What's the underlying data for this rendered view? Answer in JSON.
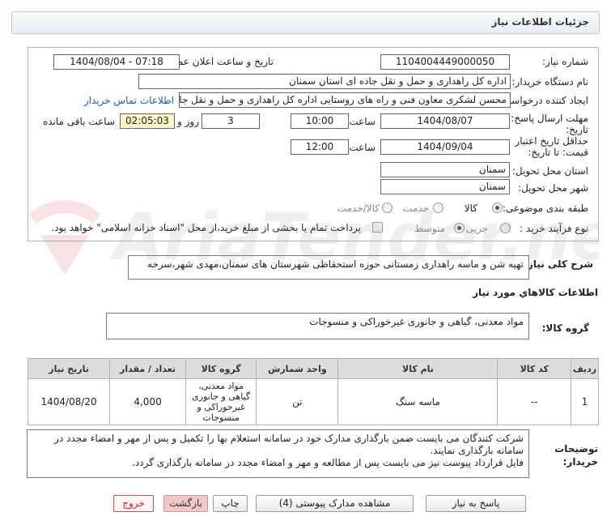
{
  "header": {
    "title": "جزئیات اطلاعات نیاز"
  },
  "fields": {
    "need_number_label": "شماره نیاز:",
    "need_number": "1104004449000050",
    "announce_label": "تاریخ و ساعت اعلان عمومی:",
    "announce_value": "1404/08/04 - 07:18",
    "buyer_org_label": "نام دستگاه خریدار:",
    "buyer_org": "اداره کل راهداری و حمل و نقل جاده ای استان سمنان",
    "creator_label": "ایجاد کننده درخواست:",
    "creator": "محسن لشکری معاون فنی و راه های روستایی اداره کل راهداری و حمل و نقل جاده",
    "contact_link": "اطلاعات تماس خریدار",
    "deadline_label": "مهلت ارسال پاسخ: تا تاریخ:",
    "deadline_date": "1404/08/07",
    "time_word": "ساعت",
    "deadline_time": "10:00",
    "days_value": "3",
    "days_word": "روز و",
    "remaining_time": "02:05:03",
    "remaining_label": "ساعت باقی مانده",
    "validity_label": "حداقل تاریخ اعتبار قیمت: تا تاریخ:",
    "validity_date": "1404/09/04",
    "validity_time": "12:00",
    "province_label": "استان محل تحویل:",
    "province": "سمنان",
    "city_label": "شهر محل تحویل:",
    "city": "سمنان",
    "category_label": "طبقه بندی موضوعی:",
    "category_options": [
      "کالا",
      "خدمت",
      "کالا/خدمت"
    ],
    "process_label": "نوع فرآیند خرید :",
    "process_options": [
      "جزیی",
      "متوسط"
    ],
    "payment_note": "پرداخت تمام یا بخشی از مبلغ خرید،از محل \"اسناد خزانه اسلامی\" خواهد بود."
  },
  "description": {
    "label": "شرح کلی نیاز:",
    "text": "تهیه شن و ماسه راهداری زمستانی حوزه استحفاظی شهرستان های سمنان،مهدی شهر،سرخه"
  },
  "goods_info_title": "اطلاعات کالاهاي مورد نياز",
  "goods_group": {
    "label": "گروه کالا:",
    "value": "مواد معدنی، گیاهی و جانوری غیرخوراکی و منسوجات"
  },
  "table": {
    "headers": [
      "ردیف",
      "کد کالا",
      "نام کالا",
      "واحد شمارش",
      "گروه کالا",
      "تعداد / مقدار",
      "تاریخ نیاز"
    ],
    "rows": [
      [
        "1",
        "--",
        "ماسه سنگ",
        "تن",
        "مواد معدنی، گیاهی و جانوری غیرخوراکی و منسوجات",
        "4,000",
        "1404/08/20"
      ]
    ]
  },
  "buyer_notes": {
    "label": "توضیحات خریدار:",
    "line1": "شرکت کنندگان می بایست ضمن بارگذاری مدارک خود در سامانه استعلام بها را تکمیل و پس از مهر و امضاء مجدد در سامانه بارگذاری نمایند.",
    "line2": "فایل قرارداد پیوست نیز می بایست پس از مطالعه و مهر و امضاء مجدد در سامانه بارگذاری گردد."
  },
  "buttons": {
    "reply": "پاسخ به نیاز",
    "attachments": "مشاهده مدارک پیوستی (4)",
    "print": "چاپ",
    "back": "بازگشت",
    "exit": "خروج"
  },
  "watermark_text": "AriaTender.neT"
}
